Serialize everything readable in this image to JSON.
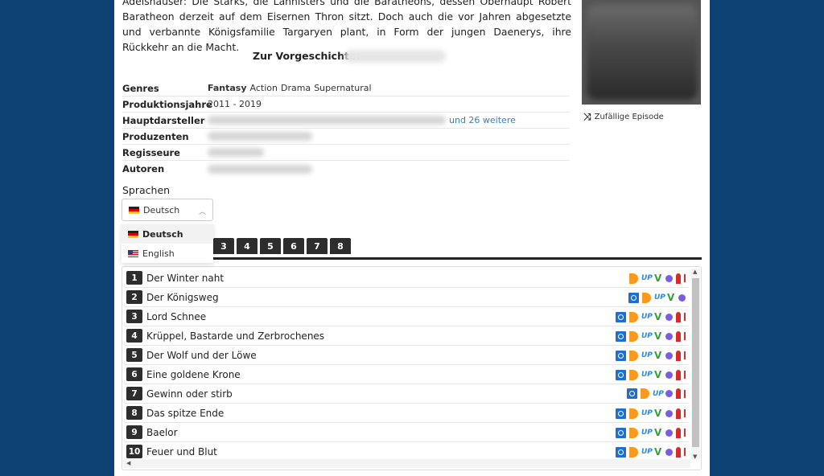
{
  "description": {
    "text": "Adelshäuser: Die Starks, die Lannisters und die Baratheons, dessen Oberhaupt Robert Baratheon derzeit auf dem Eisernen Thron sitzt. Doch auch die vor Jahren abgesetzte und verbannte Königsfamilie Targaryen plant, in Form der jungen Daenerys, ihre Rückkehr an die Macht."
  },
  "prequel": {
    "label": "Zur Vorgeschichte:"
  },
  "info": {
    "genres_label": "Genres",
    "genres": [
      "Fantasy",
      "Action",
      "Drama",
      "Supernatural"
    ],
    "years_label": "Produktionsjahre",
    "years": "2011 - 2019",
    "cast_label": "Hauptdarsteller",
    "cast_more": "und 26 weitere",
    "producers_label": "Produzenten",
    "directors_label": "Regisseure",
    "authors_label": "Autoren"
  },
  "random_episode": {
    "label": "Zufällige Episode",
    "icon": "shuffle-icon"
  },
  "languages": {
    "label": "Sprachen",
    "selected": "Deutsch",
    "options": [
      "Deutsch",
      "English"
    ]
  },
  "seasons": [
    "3",
    "4",
    "5",
    "6",
    "7",
    "8"
  ],
  "episodes": [
    {
      "num": "1",
      "title": "Der Winter naht",
      "hosters": [
        "d",
        "up",
        "v",
        "dot",
        "red"
      ]
    },
    {
      "num": "2",
      "title": "Der Königsweg",
      "hosters": [
        "vivo",
        "d",
        "up",
        "v",
        "dot"
      ]
    },
    {
      "num": "3",
      "title": "Lord Schnee",
      "hosters": [
        "vivo",
        "d",
        "up",
        "v",
        "dot",
        "red"
      ]
    },
    {
      "num": "4",
      "title": "Krüppel, Bastarde und Zerbrochenes",
      "hosters": [
        "vivo",
        "d",
        "up",
        "v",
        "dot",
        "red"
      ]
    },
    {
      "num": "5",
      "title": "Der Wolf und der Löwe",
      "hosters": [
        "vivo",
        "d",
        "up",
        "v",
        "dot",
        "red"
      ]
    },
    {
      "num": "6",
      "title": "Eine goldene Krone",
      "hosters": [
        "vivo",
        "d",
        "up",
        "v",
        "dot",
        "red"
      ]
    },
    {
      "num": "7",
      "title": "Gewinn oder stirb",
      "hosters": [
        "vivo",
        "d",
        "up",
        "dot",
        "red"
      ]
    },
    {
      "num": "8",
      "title": "Das spitze Ende",
      "hosters": [
        "vivo",
        "d",
        "up",
        "v",
        "dot",
        "red"
      ]
    },
    {
      "num": "9",
      "title": "Baelor",
      "hosters": [
        "vivo",
        "d",
        "up",
        "v",
        "dot",
        "red"
      ]
    },
    {
      "num": "10",
      "title": "Feuer und Blut",
      "hosters": [
        "vivo",
        "d",
        "up",
        "v",
        "dot",
        "red"
      ]
    }
  ],
  "colors": {
    "background": "#0e4275",
    "tab_dark": "#2d2d2d",
    "link": "#3b7fb0"
  }
}
